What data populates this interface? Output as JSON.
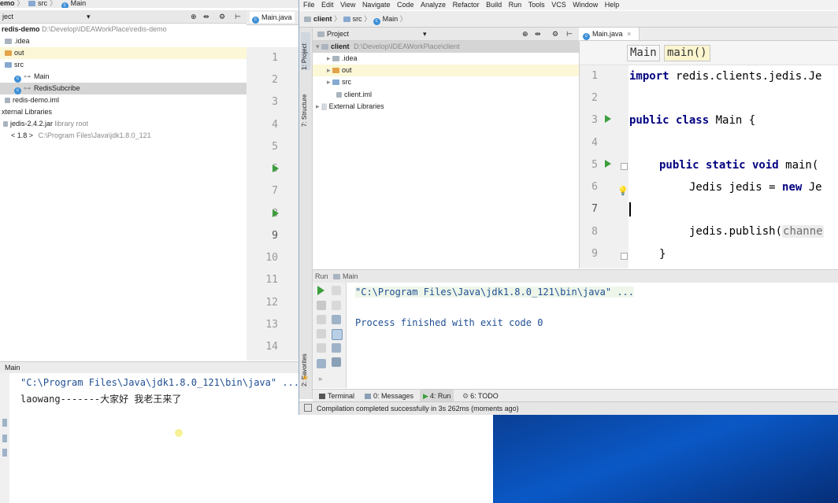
{
  "bg": {
    "crumbs": [
      "emo",
      "src",
      "Main"
    ],
    "project_label": "ject",
    "tree": [
      {
        "label": "redis-demo",
        "hint": "D:\\Develop\\IDEAWorkPlace\\redis-demo",
        "kind": "root"
      },
      {
        "label": ".idea",
        "kind": "folder-gray"
      },
      {
        "label": "out",
        "kind": "folder-orange"
      },
      {
        "label": "src",
        "kind": "folder-blue"
      },
      {
        "label": "Main",
        "kind": "class"
      },
      {
        "label": "RedisSubcribe",
        "kind": "class"
      },
      {
        "label": "redis-demo.iml",
        "kind": "file"
      },
      {
        "label": "xternal Libraries",
        "kind": "libs"
      },
      {
        "label": "jedis-2.4.2.jar",
        "hint": "library root",
        "kind": "jar"
      },
      {
        "label": "< 1.8 >",
        "hint": "C:\\Program Files\\Java\\jdk1.8.0_121",
        "kind": "jdk"
      }
    ],
    "tab_label": "Main.java",
    "line_numbers": [
      "1",
      "2",
      "3",
      "4",
      "5",
      "6",
      "7",
      "8",
      "9",
      "10",
      "11",
      "12",
      "13",
      "14"
    ],
    "run_label": "Main",
    "console": [
      "\"C:\\Program Files\\Java\\jdk1.8.0_121\\bin\\java\" ...",
      "laowang-------大家好 我老王来了"
    ]
  },
  "fg": {
    "menu": [
      "File",
      "Edit",
      "View",
      "Navigate",
      "Code",
      "Analyze",
      "Refactor",
      "Build",
      "Run",
      "Tools",
      "VCS",
      "Window",
      "Help"
    ],
    "nav": [
      "client",
      "src",
      "Main"
    ],
    "side_tabs": [
      "1: Project",
      "7: Structure",
      "2: Favorites"
    ],
    "project_label": "Project",
    "tree": [
      {
        "label": "client",
        "hint": "D:\\Develop\\IDEAWorkPlace\\client",
        "kind": "root"
      },
      {
        "label": ".idea",
        "kind": "folder-gray"
      },
      {
        "label": "out",
        "kind": "folder-orange"
      },
      {
        "label": "src",
        "kind": "folder-blue"
      },
      {
        "label": "client.iml",
        "kind": "file"
      },
      {
        "label": "External Libraries",
        "kind": "libs"
      }
    ],
    "tab_label": "Main.java",
    "code_crumbs": [
      "Main",
      "main()"
    ],
    "line_numbers": [
      "1",
      "2",
      "3",
      "4",
      "5",
      "6",
      "7",
      "8",
      "9"
    ],
    "code": {
      "l1": "redis.clients.jedis.Je",
      "l1_kw": "import",
      "l3_kw": "public class",
      "l3": " Main {",
      "l5_kw": "public static void",
      "l5": " main(",
      "l6": "Jedis jedis = ",
      "l6_kw": "new",
      "l6_tail": " Je",
      "l8": "jedis.publish(",
      "l8_hint": "channe",
      "l9": "}"
    },
    "run_label": "Run",
    "run_config": "Main",
    "console": [
      "\"C:\\Program Files\\Java\\jdk1.8.0_121\\bin\\java\" ...",
      "Process finished with exit code 0"
    ],
    "bottom_tabs": [
      "Terminal",
      "0: Messages",
      "4: Run",
      "6: TODO"
    ],
    "status": "Compilation completed successfully in 3s 262ms (moments ago)"
  }
}
